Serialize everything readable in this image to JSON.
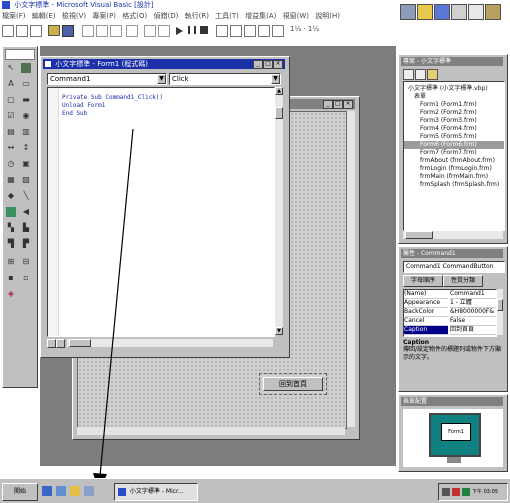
{
  "window": {
    "title": "小文字標準 - Microsoft Visual Basic [設計]"
  },
  "menubar": {
    "items": [
      "檔案(F)",
      "編輯(E)",
      "檢視(V)",
      "專案(P)",
      "格式(O)",
      "偵錯(D)",
      "執行(R)",
      "工具(T)",
      "增益集(A)",
      "視窗(W)",
      "說明(H)"
    ]
  },
  "toolbar": {
    "zoom_text": "1½ · 1½"
  },
  "code_window": {
    "title": "小文字標準 - Form1 (程式碼)",
    "object_combo": "Command1",
    "proc_combo": "Click",
    "lines": [
      "Private Sub Command1_Click()",
      "Unload Form1",
      "End Sub"
    ]
  },
  "form_designer": {
    "command_button_label": "回到首頁"
  },
  "project_explorer": {
    "title": "專案 - 小文字標準",
    "root": "小文字標準 (小文字標準.vbp)",
    "folder": "表單",
    "forms": [
      "Form1 (Form1.frm)",
      "Form2 (Form2.frm)",
      "Form3 (Form3.frm)",
      "Form4 (Form4.frm)",
      "Form5 (Form5.frm)",
      "Form6 (Form6.frm)",
      "Form7 (Form7.frm)",
      "frmAbout (frmAbout.frm)",
      "frmLogin (frmLogin.frm)",
      "frmMain (frmMain.frm)",
      "frmSplash (frmSplash.frm)"
    ],
    "selected_index": 5
  },
  "properties": {
    "title": "屬性 - Command1",
    "object_combo": "Command1 CommandButton",
    "tabs": [
      "字母順序",
      "性質分類"
    ],
    "rows": [
      {
        "name": "(Name)",
        "value": "Command1"
      },
      {
        "name": "Appearance",
        "value": "1 - 立體"
      },
      {
        "name": "BackColor",
        "value": "&H8000000F&"
      },
      {
        "name": "Cancel",
        "value": "False"
      },
      {
        "name": "Caption",
        "value": "回到首頁"
      }
    ],
    "selected_row": 4,
    "desc_title": "Caption",
    "desc_text": "傳回/設定物件的標題列或物件下方顯示的文字。"
  },
  "form_layout": {
    "title": "表單配置",
    "preview_label": "Form1"
  },
  "taskbar": {
    "start_label": "開始",
    "task_label": "小文字標準 - Micr...",
    "clock": "下午 03:05"
  },
  "colors": {
    "title_active": "#1a2fa8",
    "desktop": "#c0c0c0",
    "mdi_bg": "#7d7d7d",
    "selected": "#00008a",
    "preview_teal": "#108080"
  }
}
